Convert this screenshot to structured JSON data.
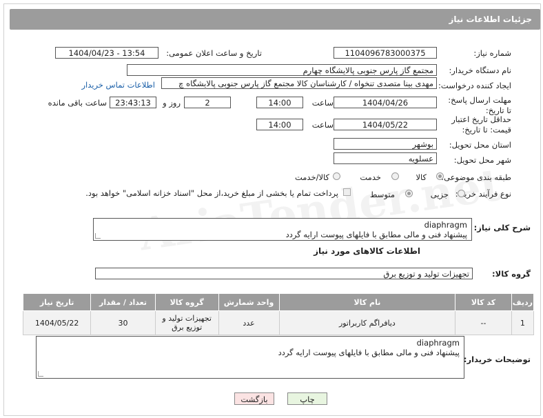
{
  "header": {
    "title": "جزئیات اطلاعات نیاز"
  },
  "form": {
    "need_number_label": "شماره نیاز:",
    "need_number": "1104096783000375",
    "announce_label": "تاریخ و ساعت اعلان عمومی:",
    "announce_value": "1404/04/23 - 13:54",
    "buyer_org_label": "نام دستگاه خریدار:",
    "buyer_org": "مجتمع گاز پارس جنوبی  پالایشگاه چهارم",
    "creator_label": "ایجاد کننده درخواست:",
    "creator": "مهدی بینا متصدی تنخواه / کارشناسان کالا مجتمع گاز پارس جنوبی  پالایشگاه چ",
    "contact_link": "اطلاعات تماس خریدار",
    "reply_deadline_label": "مهلت ارسال پاسخ: تا تاریخ:",
    "reply_date": "1404/04/26",
    "time_label": "ساعت",
    "reply_time": "14:00",
    "days_value": "2",
    "days_label": "روز و",
    "remaining_value": "23:43:13",
    "remaining_label": "ساعت باقی مانده",
    "price_deadline_label": "حداقل تاریخ اعتبار قیمت: تا تاریخ:",
    "price_date": "1404/05/22",
    "price_time": "14:00",
    "province_label": "استان محل تحویل:",
    "province": "بوشهر",
    "city_label": "شهر محل تحویل:",
    "city": "عسلویه",
    "category_label": "طبقه بندی موضوعی:",
    "category_options": [
      "کالا",
      "خدمت",
      "کالا/خدمت"
    ],
    "process_label": "نوع فرآیند خرید :",
    "process_options": [
      "جزیی",
      "متوسط"
    ],
    "payment_note": "پرداخت تمام یا بخشی از مبلغ خرید،از محل \"اسناد خزانه اسلامی\" خواهد بود."
  },
  "description": {
    "label": "شرح کلی نیاز:",
    "line1": "diaphragm",
    "line2": "پیشنهاد فنی و مالی مطابق با فایلهای پیوست ارایه گردد"
  },
  "goods_section_title": "اطلاعات کالاهای مورد نیاز",
  "goods_group": {
    "label": "گروه کالا:",
    "value": "تجهیزات تولید و توزیع برق"
  },
  "table": {
    "headers": [
      "ردیف",
      "کد کالا",
      "نام کالا",
      "واحد شمارش",
      "گروه کالا",
      "تعداد / مقدار",
      "تاریخ نیاز"
    ],
    "rows": [
      [
        "1",
        "--",
        "دیافراگم کاربراتور",
        "عدد",
        "تجهیزات تولید و توزیع برق",
        "30",
        "1404/05/22"
      ]
    ]
  },
  "buyer_notes": {
    "label": "توضیحات خریدار:",
    "line1": "diaphragm",
    "line2": "پیشنهاد فنی و مالی مطابق با فایلهای پیوست ارایه گردد"
  },
  "buttons": {
    "print": "چاپ",
    "back": "بازگشت"
  },
  "colors": {
    "header_bg": "#9c9c9c",
    "print_bg": "#e8f5e0",
    "back_bg": "#fbe3e3",
    "link": "#1a5fa8"
  }
}
